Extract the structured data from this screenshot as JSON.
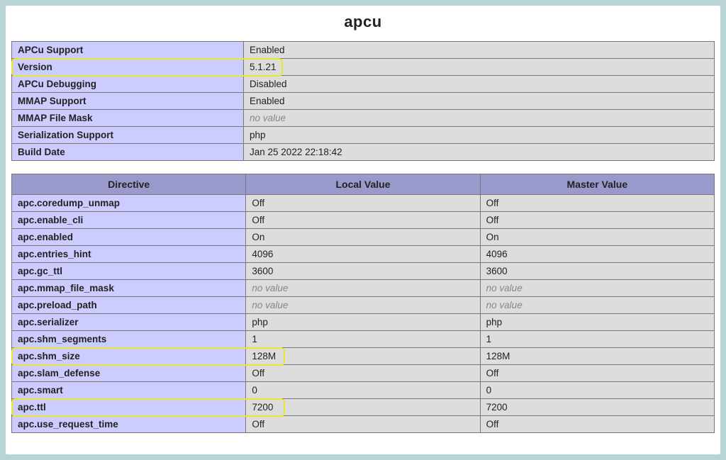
{
  "title": "apcu",
  "info_rows": [
    {
      "key": "APCu Support",
      "value": "Enabled",
      "novalue": false
    },
    {
      "key": "Version",
      "value": "5.1.21",
      "novalue": false,
      "highlight": true
    },
    {
      "key": "APCu Debugging",
      "value": "Disabled",
      "novalue": false
    },
    {
      "key": "MMAP Support",
      "value": "Enabled",
      "novalue": false
    },
    {
      "key": "MMAP File Mask",
      "value": "no value",
      "novalue": true
    },
    {
      "key": "Serialization Support",
      "value": "php",
      "novalue": false
    },
    {
      "key": "Build Date",
      "value": "Jan 25 2022 22:18:42",
      "novalue": false
    }
  ],
  "directive_headers": {
    "directive": "Directive",
    "local": "Local Value",
    "master": "Master Value"
  },
  "directive_rows": [
    {
      "name": "apc.coredump_unmap",
      "local": "Off",
      "master": "Off",
      "local_nv": false,
      "master_nv": false
    },
    {
      "name": "apc.enable_cli",
      "local": "Off",
      "master": "Off",
      "local_nv": false,
      "master_nv": false
    },
    {
      "name": "apc.enabled",
      "local": "On",
      "master": "On",
      "local_nv": false,
      "master_nv": false
    },
    {
      "name": "apc.entries_hint",
      "local": "4096",
      "master": "4096",
      "local_nv": false,
      "master_nv": false
    },
    {
      "name": "apc.gc_ttl",
      "local": "3600",
      "master": "3600",
      "local_nv": false,
      "master_nv": false
    },
    {
      "name": "apc.mmap_file_mask",
      "local": "no value",
      "master": "no value",
      "local_nv": true,
      "master_nv": true
    },
    {
      "name": "apc.preload_path",
      "local": "no value",
      "master": "no value",
      "local_nv": true,
      "master_nv": true
    },
    {
      "name": "apc.serializer",
      "local": "php",
      "master": "php",
      "local_nv": false,
      "master_nv": false
    },
    {
      "name": "apc.shm_segments",
      "local": "1",
      "master": "1",
      "local_nv": false,
      "master_nv": false
    },
    {
      "name": "apc.shm_size",
      "local": "128M",
      "master": "128M",
      "local_nv": false,
      "master_nv": false,
      "highlight": true
    },
    {
      "name": "apc.slam_defense",
      "local": "Off",
      "master": "Off",
      "local_nv": false,
      "master_nv": false
    },
    {
      "name": "apc.smart",
      "local": "0",
      "master": "0",
      "local_nv": false,
      "master_nv": false
    },
    {
      "name": "apc.ttl",
      "local": "7200",
      "master": "7200",
      "local_nv": false,
      "master_nv": false,
      "highlight": true
    },
    {
      "name": "apc.use_request_time",
      "local": "Off",
      "master": "Off",
      "local_nv": false,
      "master_nv": false
    }
  ]
}
